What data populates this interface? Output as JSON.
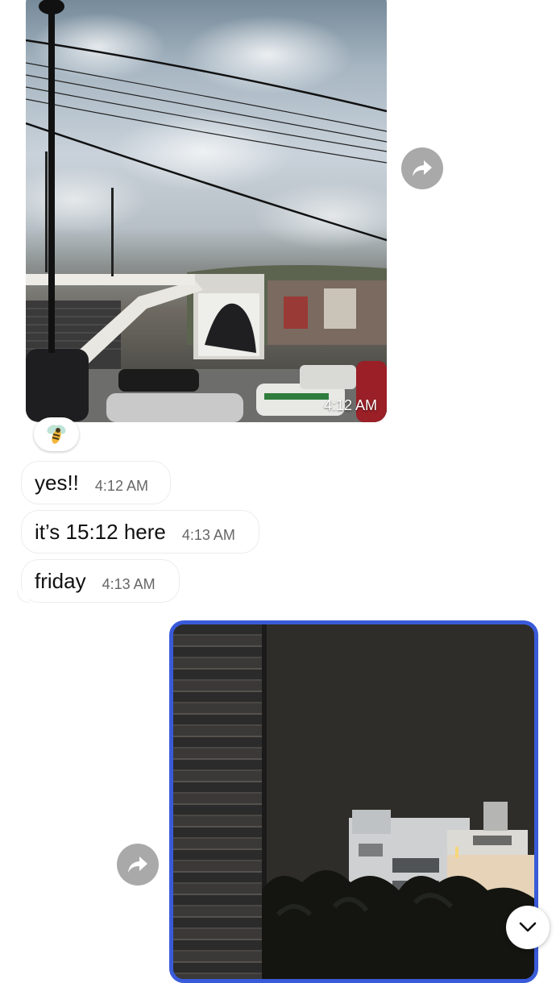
{
  "messages": [
    {
      "type": "photo",
      "direction": "incoming",
      "time": "4:12 AM",
      "reaction": "bee-emoji"
    },
    {
      "type": "text",
      "direction": "incoming",
      "text": "yes!!",
      "time": "4:12 AM"
    },
    {
      "type": "text",
      "direction": "incoming",
      "text": "it’s 15:12 here",
      "time": "4:13 AM"
    },
    {
      "type": "text",
      "direction": "incoming",
      "text": "friday",
      "time": "4:13 AM"
    },
    {
      "type": "photo",
      "direction": "outgoing",
      "selected": true
    }
  ],
  "icons": {
    "forward": "forward-arrow-icon",
    "scroll_down": "chevron-down-icon",
    "reaction": "bee-emoji"
  },
  "colors": {
    "selection_border": "#3a5bd9",
    "forward_button": "#a9a9a9",
    "bubble_bg": "#ffffff"
  }
}
